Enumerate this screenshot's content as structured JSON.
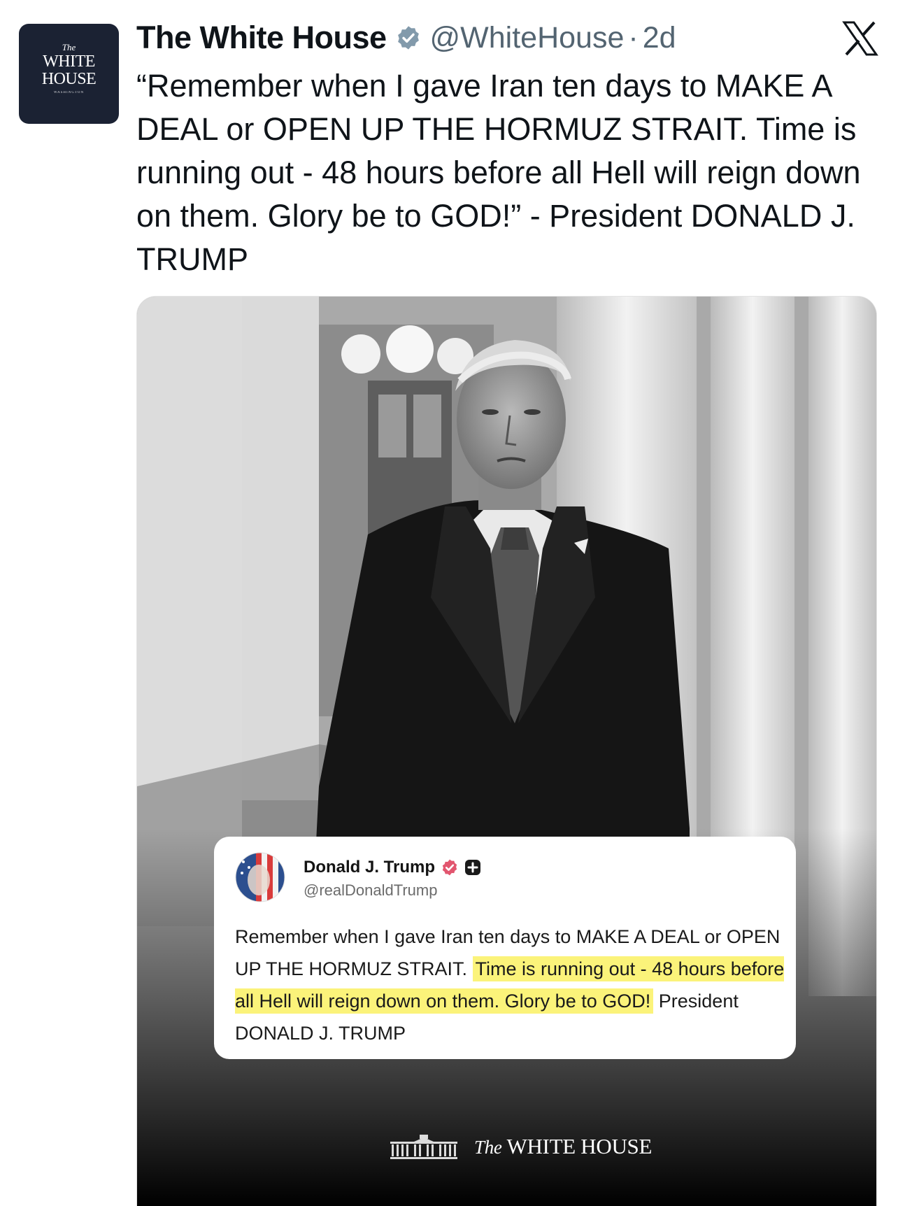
{
  "account": {
    "avatar": {
      "the": "The",
      "white": "WHITE",
      "house": "HOUSE",
      "sub": "WASHINGTON"
    },
    "name": "The White House",
    "handle": "@WhiteHouse",
    "separator": "·",
    "age": "2d",
    "verified_color": "#829aab"
  },
  "tweet": {
    "text": "“Remember when I gave Iran ten days to MAKE A DEAL or OPEN UP THE HORMUZ STRAIT. Time is running out - 48 hours before all Hell will reign down on them. Glory be to GOD!” - President DONALD J. TRUMP"
  },
  "media": {
    "quote_card": {
      "name": "Donald J. Trump",
      "handle": "@realDonaldTrump",
      "verified_color": "#e2566f",
      "text_plain_1": "Remember when I gave Iran ten days to MAKE A DEAL or OPEN UP THE HORMUZ STRAIT.",
      "text_highlight": "Time is running out - 48 hours before all Hell will reign down on them. Glory be to GOD!",
      "text_plain_2": "President DONALD J. TRUMP",
      "highlight_color": "#fbf37a"
    },
    "footer": {
      "the": "The",
      "white_house": "WHITE HOUSE"
    }
  },
  "icons": {
    "verified": "verified-badge-icon",
    "platform": "x-logo-icon",
    "plus": "plus-badge-icon"
  }
}
